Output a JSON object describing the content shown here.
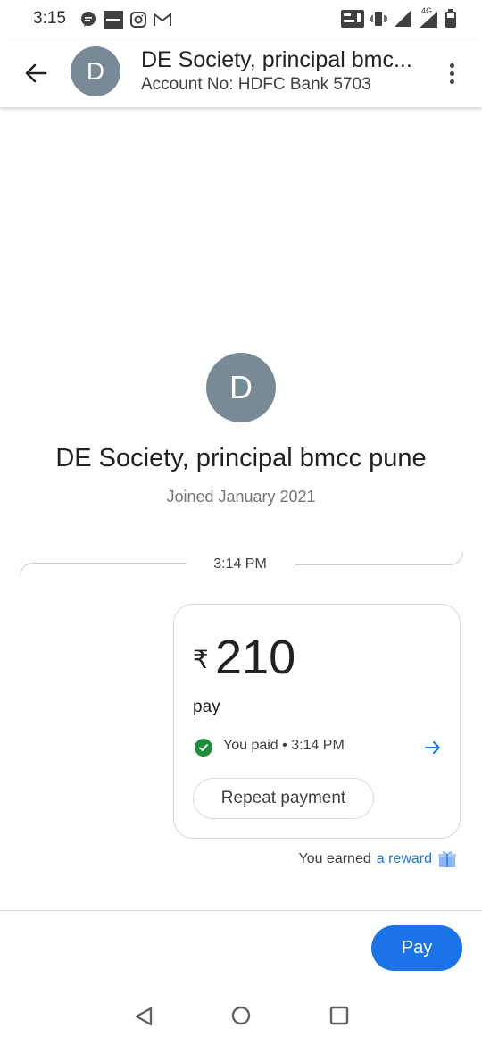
{
  "status_bar": {
    "time": "3:15",
    "left_icons": [
      "chat-bubble-icon",
      "zomato-icon",
      "instagram-icon",
      "gmail-icon"
    ],
    "right_icons": [
      "volte-icon",
      "vibrate-icon",
      "signal-icon",
      "4g-signal-icon",
      "battery-icon"
    ],
    "network_label": "4G"
  },
  "header": {
    "avatar_letter": "D",
    "title": "DE Society, principal bmc...",
    "subtitle": "Account No: HDFC Bank 5703"
  },
  "profile": {
    "avatar_letter": "D",
    "name": "DE Society, principal bmcc pune",
    "joined": "Joined January 2021"
  },
  "timeline": {
    "time": "3:14 PM"
  },
  "payment": {
    "currency_symbol": "₹",
    "amount": "210",
    "note": "pay",
    "status": "You paid • 3:14 PM",
    "repeat_label": "Repeat payment"
  },
  "reward": {
    "prefix": "You earned",
    "link": "a reward"
  },
  "actions": {
    "pay_label": "Pay"
  },
  "colors": {
    "accent": "#1a73e8",
    "avatar": "#778a95",
    "success": "#1e8e3e"
  }
}
